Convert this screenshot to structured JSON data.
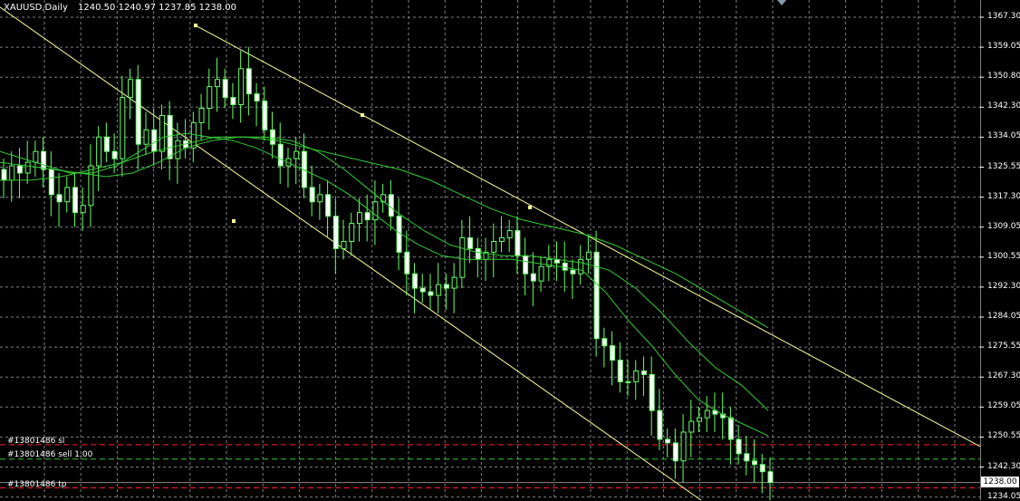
{
  "header": {
    "symbol": "XAUUSD,Daily",
    "ohlc": "1240.50 1240.97 1237.85 1238.00"
  },
  "y_axis": {
    "labels": [
      "1367.30",
      "1359.05",
      "1350.80",
      "1342.30",
      "1334.05",
      "1325.55",
      "1317.30",
      "1309.05",
      "1300.55",
      "1292.30",
      "1284.05",
      "1275.55",
      "1267.30",
      "1259.05",
      "1250.55",
      "1242.30"
    ],
    "current_price": "1238.00",
    "bottom_label": "1234.05"
  },
  "orders": {
    "sl": "#13801486 sl",
    "sell": "#13801486 sell 1.00",
    "tp": "#13801486 tp"
  },
  "colors": {
    "background": "#000000",
    "grid": "#7f7f7f",
    "candle": "#66ff66",
    "ma": "#33cc33",
    "channel": "#ffff99",
    "order_sl_tp": "#ff2222",
    "order_entry": "#33cc33"
  },
  "chart_data": {
    "type": "candlestick",
    "symbol": "XAUUSD",
    "timeframe": "Daily",
    "ylim": [
      1234.05,
      1370
    ],
    "last_close": 1238.0,
    "closes": [
      1322,
      1326,
      1324,
      1327,
      1330,
      1325,
      1318,
      1316,
      1320,
      1313,
      1315,
      1326,
      1334,
      1330,
      1328,
      1345,
      1350,
      1332,
      1336,
      1330,
      1340,
      1328,
      1333,
      1331,
      1338,
      1342,
      1348,
      1350,
      1345,
      1343,
      1353,
      1346,
      1344,
      1336,
      1332,
      1326,
      1328,
      1330,
      1320,
      1316,
      1318,
      1312,
      1303,
      1305,
      1310,
      1313,
      1311,
      1316,
      1318,
      1312,
      1302,
      1296,
      1292,
      1291,
      1290,
      1293,
      1292,
      1295,
      1306,
      1303,
      1300,
      1302,
      1305,
      1306,
      1308,
      1301,
      1296,
      1294,
      1298,
      1300,
      1299,
      1297,
      1296,
      1300,
      1302,
      1278,
      1276,
      1272,
      1266,
      1266,
      1269,
      1268,
      1258,
      1250,
      1249,
      1244,
      1252,
      1255,
      1256,
      1258,
      1257,
      1256,
      1250,
      1246,
      1244,
      1243,
      1241,
      1238
    ],
    "moving_averages": [
      {
        "values": [
          1330,
          1328,
          1326,
          1324,
          1324,
          1326,
          1330,
          1334,
          1335,
          1334,
          1333,
          1331,
          1328,
          1325,
          1322,
          1318,
          1313,
          1308,
          1304,
          1301,
          1300,
          1300,
          1300,
          1299,
          1298,
          1297,
          1291,
          1283,
          1276,
          1268,
          1261,
          1257,
          1254,
          1251
        ]
      },
      {
        "values": [
          1327,
          1326,
          1325,
          1324,
          1323,
          1324,
          1327,
          1331,
          1333,
          1334,
          1334,
          1333,
          1330,
          1325,
          1319,
          1313,
          1308,
          1304,
          1302,
          1301,
          1301,
          1300,
          1299,
          1297,
          1292,
          1285,
          1277,
          1270,
          1265,
          1258
        ]
      },
      {
        "values": [
          1322,
          1322,
          1323,
          1325,
          1327,
          1330,
          1332,
          1334,
          1334,
          1333,
          1331,
          1329,
          1327,
          1325,
          1322,
          1318,
          1314,
          1311,
          1309,
          1307,
          1304,
          1300,
          1296,
          1291,
          1286,
          1281
        ]
      }
    ],
    "orders": [
      {
        "label": "#13801486 sl",
        "price": 1248.5
      },
      {
        "label": "#13801486 sell 1.00",
        "price": 1244.5
      },
      {
        "label": "#13801486 tp",
        "price": 1236.5
      }
    ],
    "channel": {
      "upper_start": 1365,
      "upper_end": 1248,
      "lower_start": 1355,
      "lower_end": 1232
    }
  }
}
